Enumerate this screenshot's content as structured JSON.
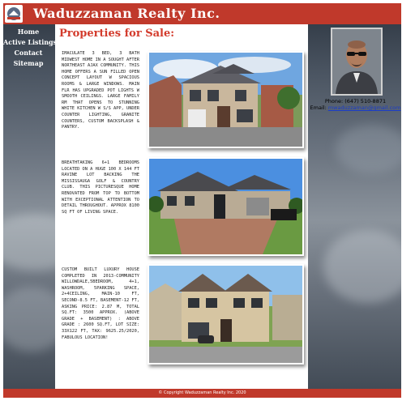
{
  "header": {
    "title": "Waduzzaman Realty Inc."
  },
  "nav": {
    "items": [
      "Home",
      "Active Listings",
      "Contact",
      "Sitemap"
    ]
  },
  "main": {
    "heading": "Properties for Sale:",
    "listings": [
      {
        "description": "Imaculate 3 bed, 3 bath midwest home in a sought after northeast ajax community. This home offers a sun filled open concept layout w spacious rooms & large windows. main flr has upgraded pot lights w smooth ceilings. large family rm that opens to stunning white kitchen w s/s app, under counter lighting, granite counters, custom backsplash & pantry."
      },
      {
        "description": "Breathtaking 6+1 Bedrooms located on a huge 100 x 144 ft ravine lot backing the Mississauga golf & country club. This picturesque home renovated from top to bottom with exceptional attention to detail throughout. Approx 8100 sq ft of living space."
      },
      {
        "description": "Custom built luxury house completed in 2013-community willowdale,5bedroom, 4+1, washroom, 5parking space, 2+4ceiling, main-10 ft, second-8.5 ft, basement-12 ft, asking price: 2.87 m, total sq.ft: 3500 approx. (above grade + basement) : above grade : 2600 sq.ft, lot size: 33x122 ft, tax: 9625.25/2020, fabulous location!"
      }
    ]
  },
  "agent": {
    "phone": "Phone: (647) 510-8871",
    "email_label": "Email:",
    "email": "mwaduzzaman@gmail.com"
  },
  "footer": {
    "text": "© Copyright Waduzzaman Realty Inc. 2020"
  },
  "colors": {
    "brand_red": "#c0392b",
    "heading_red": "#d33b2c",
    "link_blue": "#1a3cc9"
  }
}
